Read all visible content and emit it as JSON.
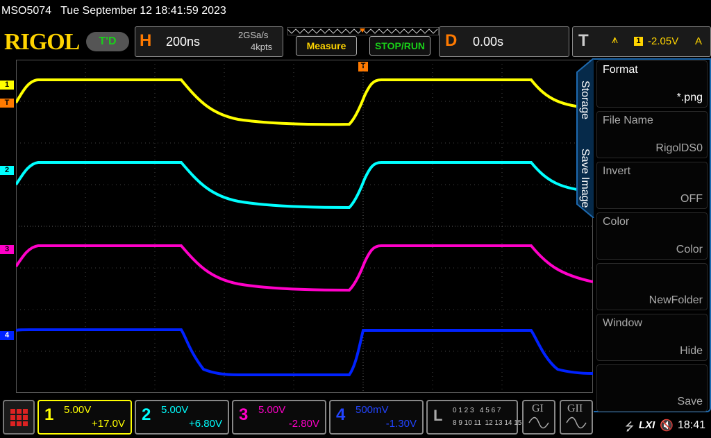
{
  "title": {
    "model": "MSO5074",
    "datetime": "Tue September 12 18:41:59 2023"
  },
  "toolbar": {
    "brand": "RIGOL",
    "status": "T'D",
    "horizontal": {
      "label": "H",
      "timebase": "200ns",
      "sample_rate": "2GSa/s",
      "memory_depth": "4kpts"
    },
    "measure_label": "Measure",
    "stop_run_label": "STOP/RUN",
    "delay": {
      "label": "D",
      "value": "0.00s"
    },
    "trigger": {
      "label": "T",
      "source": "1",
      "level": "-2.05V",
      "mode": "A"
    }
  },
  "channel_markers": [
    "1",
    "T",
    "2",
    "3",
    "4"
  ],
  "trigger_marker": "T",
  "side_menu": {
    "tabs": [
      "Storage",
      "Save Image"
    ],
    "items": [
      {
        "label": "Format",
        "value": "*.png"
      },
      {
        "label": "File Name",
        "value": "RigolDS0"
      },
      {
        "label": "Invert",
        "value": "OFF"
      },
      {
        "label": "Color",
        "value": "Color"
      },
      {
        "label": "",
        "value": "NewFolder"
      },
      {
        "label": "Window",
        "value": "Hide"
      },
      {
        "label": "",
        "value": "Save"
      }
    ]
  },
  "channels": [
    {
      "num": "1",
      "scale": "5.00V",
      "offset": "+17.0V",
      "color": "#ffff00"
    },
    {
      "num": "2",
      "scale": "5.00V",
      "offset": "+6.80V",
      "color": "#00ffff"
    },
    {
      "num": "3",
      "scale": "5.00V",
      "offset": "-2.80V",
      "color": "#ff00c8"
    },
    {
      "num": "4",
      "scale": "500mV",
      "offset": "-1.30V",
      "color": "#0022ff"
    }
  ],
  "logic": {
    "label": "L",
    "row1": "0 1 2 3   4 5 6 7",
    "row2": "8 9 10 11  12 13 14 15"
  },
  "generators": [
    "GI",
    "GII"
  ],
  "status_bar": {
    "lxi": "LXI",
    "time": "18:41"
  }
}
